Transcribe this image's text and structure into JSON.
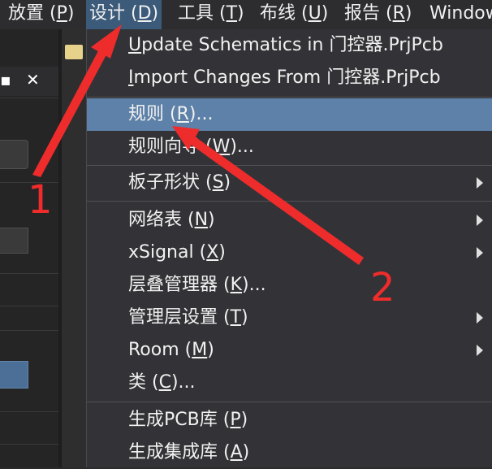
{
  "menubar": {
    "items": [
      {
        "text": "放置 (",
        "mnemonic": "P",
        "suffix": ")"
      },
      {
        "text": "设计 (",
        "mnemonic": "D",
        "suffix": ")"
      },
      {
        "text": "工具 (",
        "mnemonic": "T",
        "suffix": ")"
      },
      {
        "text": "布线 (",
        "mnemonic": "U",
        "suffix": ")"
      },
      {
        "text": "报告 (",
        "mnemonic": "R",
        "suffix": ")"
      },
      {
        "text": "Window",
        "mnemonic": "",
        "suffix": ""
      }
    ]
  },
  "panel": {
    "pin_icon": "pin-icon",
    "close_icon": "close-icon"
  },
  "design_menu": {
    "items": [
      {
        "pre": "",
        "mnemonic": "U",
        "post": "pdate Schematics in 门控器.PrjPcb",
        "submenu": false
      },
      {
        "pre": "",
        "mnemonic": "I",
        "post": "mport Changes From 门控器.PrjPcb",
        "submenu": false
      },
      {
        "pre": "规则 (",
        "mnemonic": "R",
        "post": ")...",
        "submenu": false,
        "highlighted": true
      },
      {
        "pre": "规则向导 (",
        "mnemonic": "W",
        "post": ")...",
        "submenu": false
      },
      {
        "pre": "板子形状 (",
        "mnemonic": "S",
        "post": ")",
        "submenu": true
      },
      {
        "pre": "网络表 (",
        "mnemonic": "N",
        "post": ")",
        "submenu": true
      },
      {
        "pre": "xSignal (",
        "mnemonic": "X",
        "post": ")",
        "submenu": true
      },
      {
        "pre": "层叠管理器 (",
        "mnemonic": "K",
        "post": ")...",
        "submenu": false
      },
      {
        "pre": "管理层设置 (",
        "mnemonic": "T",
        "post": ")",
        "submenu": true
      },
      {
        "pre": "Room (",
        "mnemonic": "M",
        "post": ")",
        "submenu": true
      },
      {
        "pre": "类 (",
        "mnemonic": "C",
        "post": ")...",
        "submenu": false
      },
      {
        "pre": "生成PCB库 (",
        "mnemonic": "P",
        "post": ")",
        "submenu": false
      },
      {
        "pre": "生成集成库 (",
        "mnemonic": "A",
        "post": ")",
        "submenu": false
      }
    ]
  },
  "annotations": {
    "step1": "1",
    "step2": "2",
    "color": "#ee2c2c"
  }
}
